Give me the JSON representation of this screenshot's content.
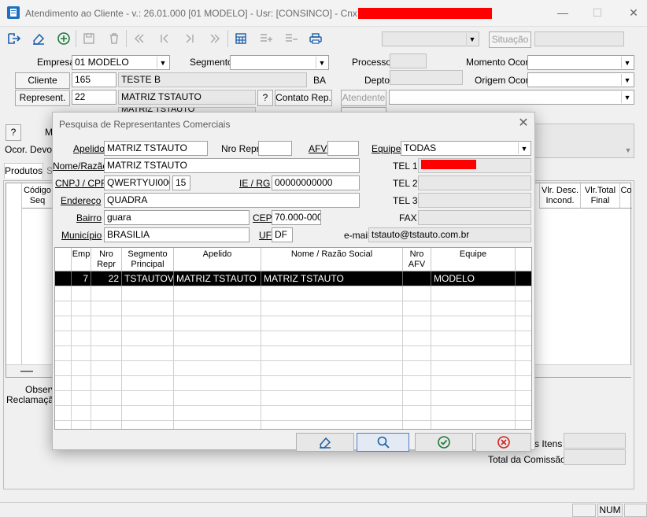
{
  "window": {
    "title": "Atendimento ao Cliente - v.: 26.01.000  [01 MODELO] - Usr: [CONSINCO] - Cnx: [",
    "min_label": "—",
    "max_label": "☐",
    "close_label": "✕"
  },
  "toolbar": {
    "items": [
      "exit-icon",
      "eraser-icon",
      "add-icon",
      "save-icon",
      "delete-icon",
      "first-icon",
      "prev-icon",
      "next-icon",
      "last-icon",
      "grid-icon",
      "add-row-icon",
      "remove-row-icon",
      "print-icon"
    ],
    "situacao_label": "Situação"
  },
  "form": {
    "empresa_label": "Empresa",
    "empresa_value": "01 MODELO",
    "segmento_label": "Segmento",
    "segmento_value": "",
    "processo_label": "Processo",
    "processo_value": "",
    "momento_label": "Momento Ocor.",
    "momento_value": "",
    "cliente_button": "Cliente",
    "cliente_code": "165",
    "cliente_name": "TESTE B",
    "cliente_uf": "BA",
    "depto_label": "Depto",
    "depto_value": "",
    "origem_label": "Origem Ocor.",
    "origem_value": "",
    "represent_button": "Represent.",
    "represent_code": "22",
    "represent_name": "MATRIZ TSTAUTO",
    "help_button": "?",
    "contato_button": "Contato Rep.",
    "atendente_button": "Atendente",
    "hidden_row_text": "MATRIZ TSTAUTO",
    "help_button_2": "?",
    "m_label": "M",
    "ocor_devol_label": "Ocor. Devol",
    "tab_produtos": "Produtos",
    "tab_s": "S",
    "codigo_seq_header": "Código Seq",
    "vlr_desc_header": "Vlr. Desc. Incond.",
    "vlr_total_header": "Vlr.Total Final",
    "co_header": "Co",
    "observ_label": "Observ",
    "reclamacao_label": "Reclamação",
    "itens_label": "s Itens",
    "total_comissao_label": "Total da Comissão"
  },
  "dialog": {
    "title": "Pesquisa de Representantes Comerciais",
    "apelido_label": "Apelido",
    "apelido_value": "MATRIZ TSTAUTO",
    "nro_repr_label": "Nro Repr",
    "nro_repr_value": "",
    "afv_label": "AFV",
    "afv_value": "",
    "equipe_label": "Equipe",
    "equipe_value": "TODAS",
    "nome_label": "Nome/Razão",
    "nome_value": "MATRIZ TSTAUTO",
    "tel1_label": "TEL 1",
    "cnpj_label": "CNPJ / CPF",
    "cnpj_value": "QWERTYUI000",
    "cnpj_dv": "15",
    "ie_label": "IE / RG",
    "ie_value": "00000000000",
    "tel2_label": "TEL 2",
    "endereco_label": "Endereço",
    "endereco_value": "QUADRA",
    "tel3_label": "TEL 3",
    "bairro_label": "Bairro",
    "bairro_value": "guara",
    "cep_label": "CEP",
    "cep_value": "70.000-000",
    "fax_label": "FAX",
    "municipio_label": "Município",
    "municipio_value": "BRASILIA",
    "uf_label": "UF",
    "uf_value": "DF",
    "email_label": "e-mail",
    "email_value": "tstauto@tstauto.com.br",
    "grid_headers": [
      "Emp",
      "Nro Repr",
      "Segmento Principal",
      "Apelido",
      "Nome / Razão Social",
      "Nro AFV",
      "Equipe"
    ],
    "grid_rows": [
      [
        "7",
        "22",
        "TSTAUTOVA",
        "MATRIZ TSTAUTO",
        "MATRIZ TSTAUTO",
        "",
        "MODELO"
      ]
    ]
  },
  "statusbar": {
    "num": "NUM"
  }
}
